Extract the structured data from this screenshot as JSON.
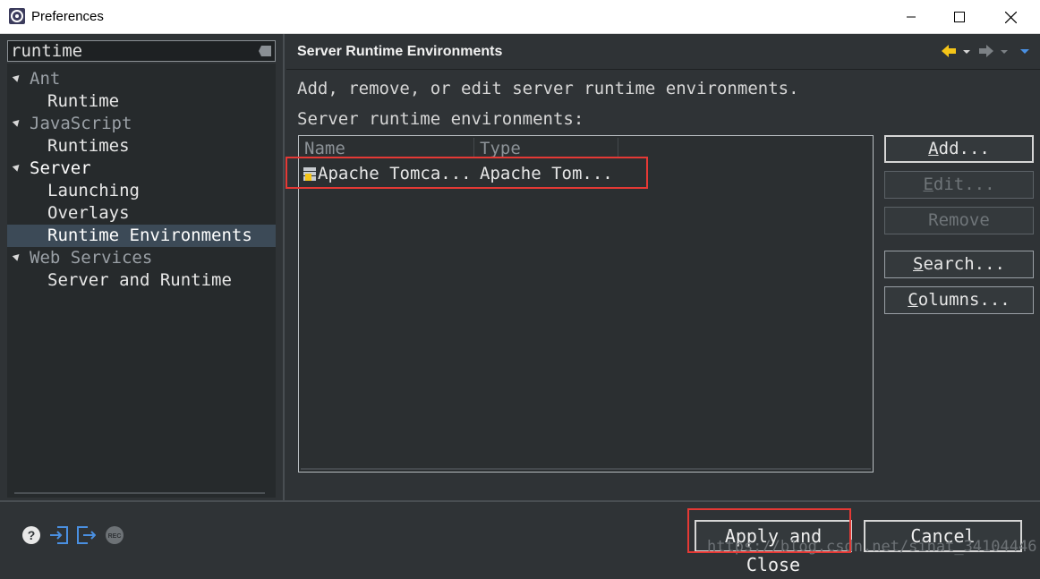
{
  "window": {
    "title": "Preferences",
    "accent": "#e53935"
  },
  "filter": {
    "value": "runtime"
  },
  "tree": {
    "items": [
      {
        "label": "Ant",
        "kind": "category"
      },
      {
        "label": "Runtime",
        "kind": "page"
      },
      {
        "label": "JavaScript",
        "kind": "category"
      },
      {
        "label": "Runtimes",
        "kind": "page"
      },
      {
        "label": "Server",
        "kind": "category"
      },
      {
        "label": "Launching",
        "kind": "page"
      },
      {
        "label": "Overlays",
        "kind": "page"
      },
      {
        "label": "Runtime Environments",
        "kind": "page",
        "selected": true
      },
      {
        "label": "Web Services",
        "kind": "category"
      },
      {
        "label": "Server and Runtime",
        "kind": "page"
      }
    ]
  },
  "page": {
    "title": "Server Runtime Environments",
    "description": "Add, remove, or edit server runtime environments.",
    "list_label": "Server runtime environments:"
  },
  "table": {
    "columns": [
      "Name",
      "Type"
    ],
    "rows": [
      {
        "name": "Apache Tomca...",
        "type": "Apache Tom..."
      }
    ]
  },
  "buttons": {
    "add": {
      "pre": "",
      "mn": "A",
      "post": "dd..."
    },
    "edit": {
      "pre": "",
      "mn": "E",
      "post": "dit..."
    },
    "remove": "Remove",
    "search": {
      "pre": "",
      "mn": "S",
      "post": "earch..."
    },
    "columns": {
      "pre": "",
      "mn": "C",
      "post": "olumns..."
    },
    "apply_close": "Apply and Close",
    "cancel": "Cancel"
  },
  "watermark": "https://blog.csdn.net/sinat_34104446",
  "icons": {
    "help": "help-icon",
    "import": "import-icon",
    "export": "export-icon",
    "record": "record-icon"
  }
}
